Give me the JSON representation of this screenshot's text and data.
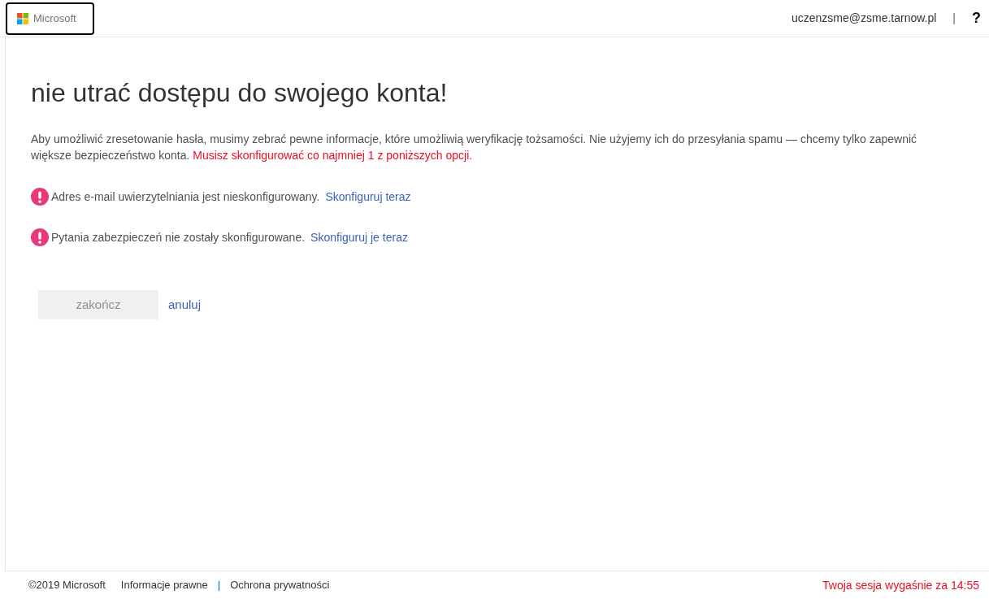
{
  "header": {
    "logo_text": "Microsoft",
    "account": "uczenzsme@zsme.tarnow.pl",
    "separator": "|",
    "help": "?"
  },
  "title": "nie utrać dostępu do swojego konta!",
  "intro": {
    "text": "Aby umożliwić zresetowanie hasła, musimy zebrać pewne informacje, które umożliwią weryfikację tożsamości. Nie użyjemy ich do przesyłania spamu — chcemy tylko zapewnić większe bezpieczeństwo konta.",
    "warning": "Musisz skonfigurować co najmniej 1 z poniższych opcji."
  },
  "items": [
    {
      "text": "Adres e-mail uwierzytelniania jest nieskonfigurowany.",
      "link": "Skonfiguruj teraz",
      "configured": false
    },
    {
      "text": "Pytania zabezpieczeń nie zostały skonfigurowane.",
      "link": "Skonfiguruj je teraz",
      "configured": false
    }
  ],
  "finish_button": {
    "label": "zakończ",
    "disabled": true
  },
  "cancel_link": "anuluj",
  "footer": {
    "copyright": "©2019 Microsoft",
    "links": [
      "Informacje prawne",
      "Ochrona prywatności"
    ],
    "separator": "|",
    "session": "Twoja sesja wygaśnie za 14:55"
  }
}
